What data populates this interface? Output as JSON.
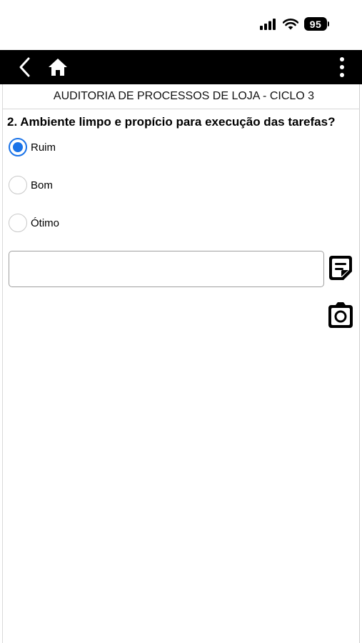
{
  "status_bar": {
    "battery": "95",
    "icons": [
      "signal-icon",
      "wifi-icon",
      "battery-icon"
    ]
  },
  "app_bar": {
    "background": "#000000",
    "icons": [
      "back-arrow-icon",
      "home-icon",
      "more-vertical-icon"
    ]
  },
  "page": {
    "title": "AUDITORIA DE PROCESSOS DE LOJA - CICLO 3"
  },
  "question": {
    "text": "2. Ambiente limpo e propício para execução das tarefas?",
    "options": [
      {
        "label": "Ruim",
        "selected": true
      },
      {
        "label": "Bom",
        "selected": false
      },
      {
        "label": "Ótimo",
        "selected": false
      }
    ],
    "comment_value": "",
    "actions": [
      "note-edit-icon",
      "camera-icon"
    ]
  },
  "colors": {
    "accent": "#1a73e8",
    "app_bar": "#000000",
    "background": "#ffffff"
  }
}
